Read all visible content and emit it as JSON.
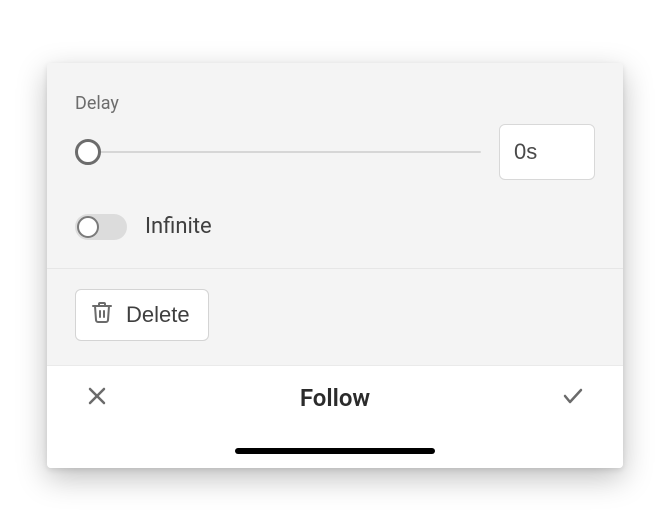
{
  "delay": {
    "label": "Delay",
    "value": "0s"
  },
  "infinite": {
    "label": "Infinite",
    "enabled": false
  },
  "delete": {
    "label": "Delete"
  },
  "footer": {
    "title": "Follow"
  }
}
